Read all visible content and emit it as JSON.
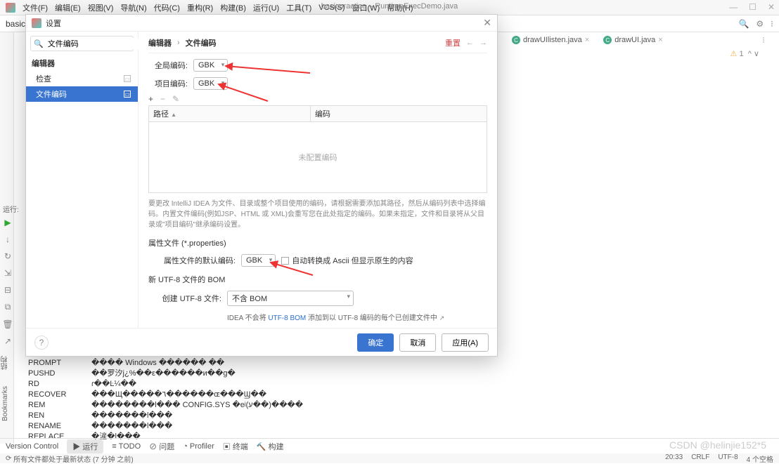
{
  "menubar": {
    "items": [
      "文件(F)",
      "编辑(E)",
      "视图(V)",
      "导航(N)",
      "代码(C)",
      "重构(R)",
      "构建(B)",
      "运行(U)",
      "工具(T)",
      "VCS(S)",
      "窗口(W)",
      "帮助(H)"
    ],
    "title": "basicpractice – RuntimeExecDemo.java"
  },
  "toolbar": {
    "project": "basicp"
  },
  "editor_tabs": [
    {
      "icon": "C",
      "label": "drawUIlisten.java"
    },
    {
      "icon": "C",
      "label": "drawUI.java"
    }
  ],
  "warn": {
    "count": "1",
    "chev": "^  ∨"
  },
  "gutter": {
    "struct": "结构",
    "bookmarks": "Bookmarks",
    "run": "运行:"
  },
  "runtools": [
    "▶",
    "↓",
    "↻",
    "⇲",
    "⊟",
    "⧉",
    "🗑",
    "↗"
  ],
  "console": [
    {
      "cmd": "PROMPT",
      "out": "���� Windows ������ ��"
    },
    {
      "cmd": "PUSHD",
      "out": "��罗汐j¿%��ε������и��g�"
    },
    {
      "cmd": "RD",
      "out": "ɾ��Ŀ¼��"
    },
    {
      "cmd": "RECOVER",
      "out": "���Щ�����٦������ɶ���Ϣ��"
    },
    {
      "cmd": "REM",
      "out": "��������l��� CONFIG.SYS �eʲ(ע��)����"
    },
    {
      "cmd": "REN",
      "out": "�������l���"
    },
    {
      "cmd": "RENAME",
      "out": "�������l���"
    },
    {
      "cmd": "REPLACE",
      "out": "�滻�l���"
    }
  ],
  "bottom_tabs": {
    "items": [
      "Version Control",
      "运行",
      "TODO",
      "问题",
      "Profiler",
      "终端",
      "构建"
    ],
    "selected": 1
  },
  "status": {
    "left": "所有文件都处于最新状态 (7 分钟 之前)",
    "right": [
      "20:33",
      "CRLF",
      "UTF-8",
      "4 个空格"
    ]
  },
  "watermark": "CSDN @helinjie152*5",
  "dialog": {
    "title": "设置",
    "search_ph": "文件编码",
    "tree": {
      "root": "编辑器",
      "child1": "检查",
      "child2": "文件编码"
    },
    "crumbs": [
      "编辑器",
      "文件编码"
    ],
    "reset": "重置",
    "global_label": "全局编码:",
    "global_val": "GBK",
    "project_label": "项目编码:",
    "project_val": "GBK",
    "tbl_tools": {
      "add": "+",
      "del": "−",
      "edit": "✎"
    },
    "tbl_head": {
      "path": "路径",
      "sort": "▲",
      "enc": "编码"
    },
    "tbl_empty": "未配置编码",
    "desc": "要更改 IntelliJ IDEA 为文件、目录或整个项目使用的编码，请根据需要添加其路径，然后从编码列表中选择编码。内置文件编码(例如JSP、HTML 或 XML)会重写您在此处指定的编码。如果未指定，文件和目录将从父目录或\"项目编码\"继承编码设置。",
    "props_title": "属性文件 (*.properties)",
    "props_label": "属性文件的默认编码:",
    "props_val": "GBK",
    "props_check": "自动转换成 Ascii 但显示原生的内容",
    "bom_title": "新 UTF-8 文件的 BOM",
    "bom_label": "创建 UTF-8 文件:",
    "bom_val": "不含 BOM",
    "bom_note_pre": "IDEA 不会将 ",
    "bom_link": "UTF-8 BOM",
    "bom_note_post": " 添加到以 UTF-8 编码的每个已创建文件中",
    "bom_arrow": "↗",
    "btn_ok": "确定",
    "btn_cancel": "取消",
    "btn_apply": "应用(A)"
  }
}
